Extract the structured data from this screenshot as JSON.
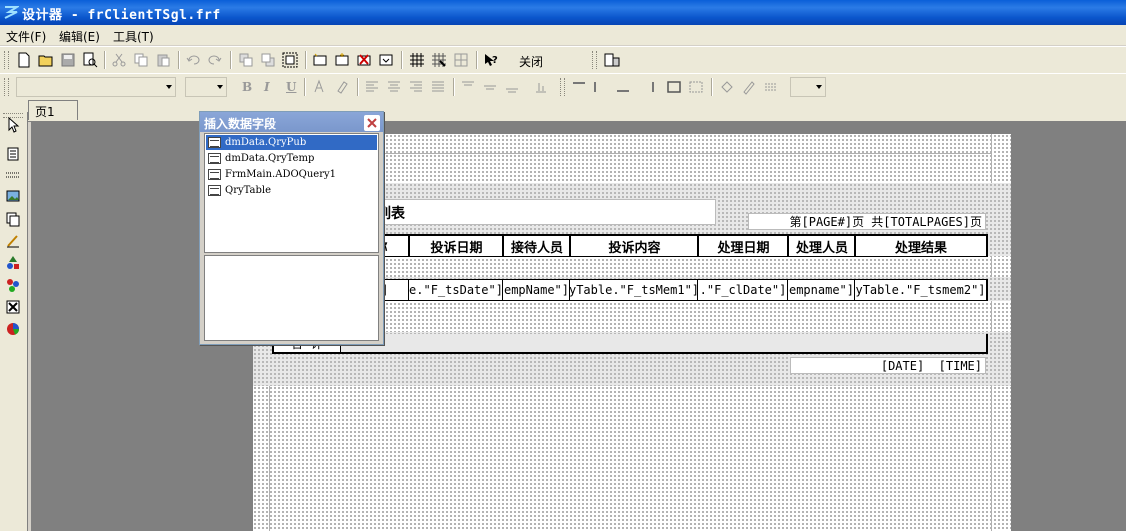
{
  "window": {
    "title": "设计器 - frClientTSgl.frf"
  },
  "menu": {
    "items": [
      "文件(F)",
      "编辑(E)",
      "工具(T)"
    ]
  },
  "toolbar": {
    "close_label": "关闭",
    "icons": [
      "new-icon",
      "open-icon",
      "save-icon",
      "preview-icon",
      "cut-icon",
      "copy-icon",
      "paste-icon",
      "undo-icon",
      "redo-icon",
      "bring-front-icon",
      "send-back-icon",
      "group-icon",
      "insert-band-icon",
      "insert-field-icon",
      "delete-icon",
      "align-icon",
      "grid-icon",
      "snap-grid-icon",
      "fit-grid-icon",
      "help-icon"
    ]
  },
  "format_toolbar": {
    "font_name": "",
    "font_size": "",
    "bold": "B",
    "italic": "I",
    "underline": "U"
  },
  "tabs": [
    {
      "label": "页1"
    }
  ],
  "report": {
    "title_fragment": "列表",
    "page_info": "第[PAGE#]页 共[TOTALPAGES]页",
    "headers": [
      "名称",
      "投诉日期",
      "接待人员",
      "投诉内容",
      "处理日期",
      "处理人员",
      "处理结果"
    ],
    "data_fields": [
      "ne\"]",
      "e.\"F_tsDate\"]",
      "empName\"]",
      "yTable.\"F_tsMem1\"]",
      ".\"F_clDate\"]",
      "empname\"]",
      "yTable.\"F_tsmem2\"]"
    ],
    "total_label": "合  计",
    "footer_date": "[DATE]  [TIME]"
  },
  "dialog": {
    "title": "插入数据字段",
    "items": [
      "dmData.QryPub",
      "dmData.QryTemp",
      "FrmMain.ADOQuery1",
      "QryTable"
    ],
    "selected_index": 0
  },
  "colors": {
    "title_bar": "#0a5fd8",
    "selection": "#316ac5",
    "workspace": "#808080",
    "dialog_title": "#7a97cc"
  }
}
